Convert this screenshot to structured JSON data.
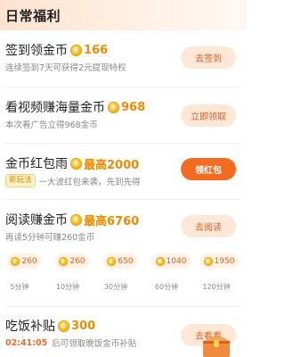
{
  "header": {
    "title": "日常福利"
  },
  "tasks": [
    {
      "title": "签到领金币",
      "amount": "166",
      "desc": "连续签到7天可获得2元提现特权",
      "button": "去签到"
    },
    {
      "title": "看视频赚海量金币",
      "amount": "968",
      "desc": "本次看广告立得968金币",
      "button": "立即领取"
    },
    {
      "title": "金币红包雨",
      "amount": "最高2000",
      "badge": "新玩法",
      "desc": "一大波红包来袭，先到先得",
      "button": "领红包"
    },
    {
      "title": "阅读赚金币",
      "amount": "最高6760",
      "desc": "再读5分钟可赚260金币",
      "button": "去阅读"
    },
    {
      "title": "吃饭补贴",
      "amount": "300",
      "countdown": "02:41:05",
      "desc": "后可领取晚饭金币补贴",
      "button": "去看看"
    }
  ],
  "reading": {
    "rewards": [
      "260",
      "260",
      "650",
      "1040",
      "1950"
    ],
    "labels": [
      "5分钟",
      "10分钟",
      "30分钟",
      "60分钟",
      "120分钟"
    ]
  },
  "colors": {
    "accent": "#f36a21",
    "amount": "#f08a00",
    "soft_button": "#fde7d6"
  }
}
